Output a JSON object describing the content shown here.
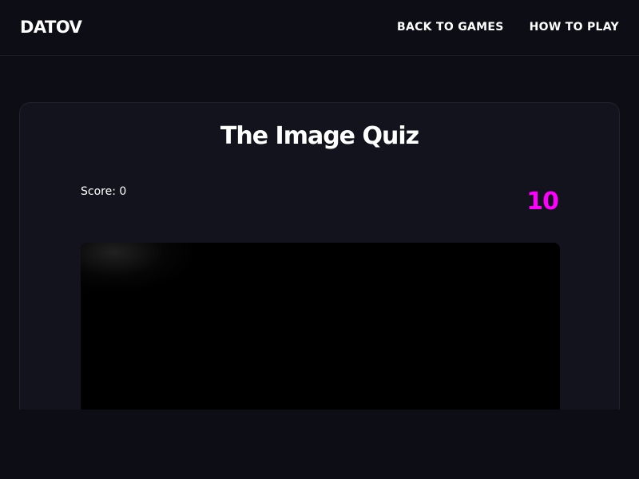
{
  "header": {
    "logo": "DATOV",
    "nav": {
      "back_to_games": "BACK TO GAMES",
      "how_to_play": "HOW TO PLAY"
    }
  },
  "game": {
    "title": "The Image Quiz",
    "score_label": "Score: 0",
    "timer": "10",
    "image": {
      "state": "obscured",
      "color": "#000000"
    }
  },
  "colors": {
    "background": "#0d0d15",
    "card": "#13131d",
    "timer_accent": "#ff00ff",
    "text": "#ffffff"
  }
}
